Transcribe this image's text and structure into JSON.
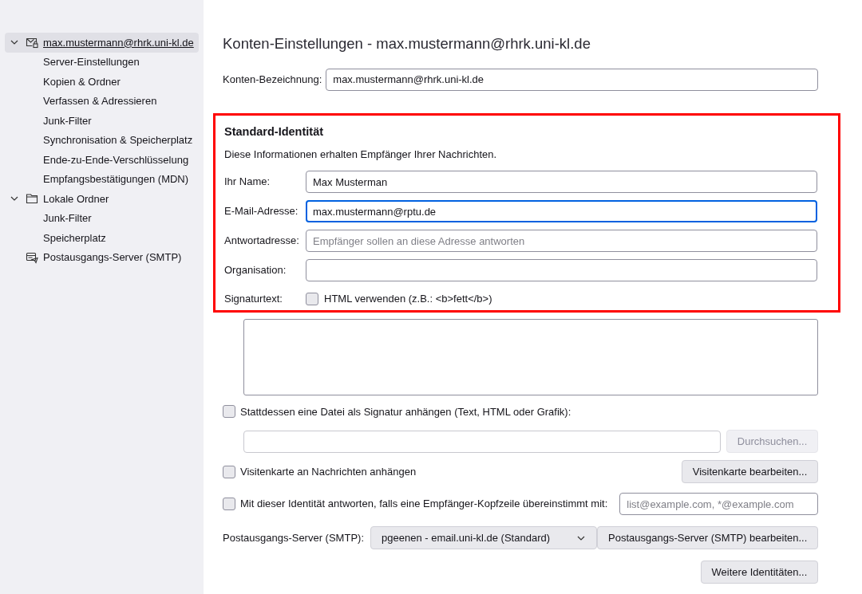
{
  "sidebar": {
    "items": [
      {
        "kind": "account",
        "label": "max.mustermann@rhrk.uni-kl.de",
        "expanded": true,
        "selected": true,
        "children": [
          {
            "label": "Server-Einstellungen",
            "selected": false
          },
          {
            "label": "Kopien & Ordner",
            "selected": false
          },
          {
            "label": "Verfassen & Adressieren",
            "selected": false
          },
          {
            "label": "Junk-Filter",
            "selected": false
          },
          {
            "label": "Synchronisation & Speicherplatz",
            "selected": false
          },
          {
            "label": "Ende-zu-Ende-Verschlüsselung",
            "selected": false
          },
          {
            "label": "Empfangsbestätigungen (MDN)",
            "selected": false
          }
        ]
      },
      {
        "kind": "folder",
        "label": "Lokale Ordner",
        "expanded": true,
        "selected": false,
        "children": [
          {
            "label": "Junk-Filter",
            "selected": false
          },
          {
            "label": "Speicherplatz",
            "selected": false
          }
        ]
      },
      {
        "kind": "smtp",
        "label": "Postausgangs-Server (SMTP)",
        "selected": false
      }
    ]
  },
  "main": {
    "title": "Konten-Einstellungen - max.mustermann@rhrk.uni-kl.de",
    "account_name": {
      "label": "Konten-Bezeichnung:",
      "value": "max.mustermann@rhrk.uni-kl.de"
    },
    "identity": {
      "heading": "Standard-Identität",
      "description": "Diese Informationen erhalten Empfänger Ihrer Nachrichten.",
      "fields": [
        {
          "label": "Ihr Name:",
          "value": "Max Musterman",
          "focused": false
        },
        {
          "label": "E-Mail-Adresse:",
          "value": "max.mustermann@rptu.de",
          "focused": true
        },
        {
          "label": "Antwortadresse:",
          "placeholder": "Empfänger sollen an diese Adresse antworten",
          "focused": false
        },
        {
          "label": "Organisation:",
          "focused": false
        }
      ],
      "signature": {
        "label": "Signaturtext:",
        "html_checkbox": {
          "label": "HTML verwenden (z.B.: <b>fett</b>)",
          "checked": false
        }
      }
    },
    "attach_file": {
      "label": "Stattdessen eine Datei als Signatur anhängen (Text, HTML oder Grafik):",
      "checked": false
    },
    "browse_button": {
      "label": "Durchsuchen...",
      "disabled": true
    },
    "vcard": {
      "label": "Visitenkarte an Nachrichten anhängen",
      "checked": false
    },
    "vcard_button": {
      "label": "Visitenkarte bearbeiten...",
      "disabled": false
    },
    "reply_identity": {
      "label": "Mit dieser Identität antworten, falls eine Empfänger-Kopfzeile übereinstimmt mit:",
      "checked": false,
      "placeholder": "list@example.com, *@example.com"
    },
    "smtp": {
      "label": "Postausgangs-Server (SMTP):",
      "value": "pgeenen - email.uni-kl.de (Standard)",
      "button": "Postausgangs-Server (SMTP) bearbeiten..."
    },
    "more_button": {
      "label": "Weitere Identitäten...",
      "disabled": false
    }
  }
}
